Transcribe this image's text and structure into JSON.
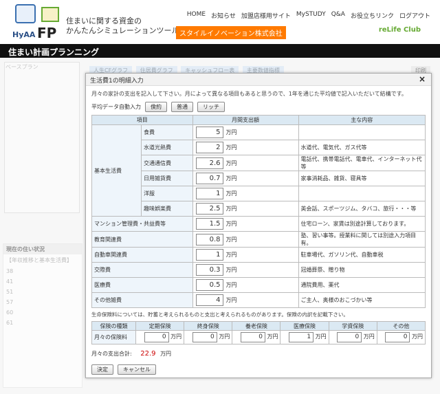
{
  "header": {
    "logo_text": "HyAA",
    "logo_fp": "FP",
    "title_line1": "住まいに関する資金の",
    "title_line2": "かんたんシミュレーションツール",
    "company": "スタイルイノベーション株式会社",
    "nav": [
      "HOME",
      "お知らせ",
      "加盟店様用サイト",
      "MySTUDY",
      "Q&A",
      "お役立ちリンク",
      "ログアウト"
    ],
    "partner": "reLife Club"
  },
  "titlebar": "住まい計画プランニング",
  "background": {
    "panel_label": "ベースプラン",
    "tabs": [
      "人生CFグラフ",
      "住居費グラフ",
      "キャッシュフロー表",
      "主要数値指標"
    ],
    "print": "印刷",
    "status_title": "現在の住い状況",
    "status_sub": "【年収推移と基本生活費】",
    "rows": [
      "38",
      "41",
      "51",
      "57",
      "60",
      "61"
    ]
  },
  "modal": {
    "title": "生活費1の明細入力",
    "close": "×",
    "instruction": "月々の家計の支出を記入して下さい。月によって異なる項目もあると思うので、1年を通じた平均値で記入いただいて結構です。",
    "preset_label": "平均データ自動入力",
    "presets": [
      "倹約",
      "普通",
      "リッチ"
    ],
    "headers": [
      "項目",
      "月間支出額",
      "主な内容"
    ],
    "unit": "万円",
    "basic_label": "基本生活費",
    "basic_items": [
      {
        "label": "食費",
        "value": "5",
        "desc": ""
      },
      {
        "label": "水道光熱費",
        "value": "2",
        "desc": "水道代、電気代、ガス代等"
      },
      {
        "label": "交通通信費",
        "value": "2.6",
        "desc": "電話代、携帯電話代、電車代、インターネット代等"
      },
      {
        "label": "日用雑貨費",
        "value": "0.7",
        "desc": "家事消耗品、雑貨、寝具等"
      },
      {
        "label": "洋服",
        "value": "1",
        "desc": ""
      },
      {
        "label": "趣味娯楽費",
        "value": "2.5",
        "desc": "英会話、スポーツジム、タバコ、旅行・・・等"
      }
    ],
    "other_items": [
      {
        "label": "マンション管理費・共益費等",
        "value": "1.5",
        "desc": "住宅ローン、家賃は別途計算しております。"
      },
      {
        "label": "教育関連費",
        "value": "0.8",
        "desc": "塾、習い事等。授業料に関しては別途入力項目有。"
      },
      {
        "label": "自動車関連費",
        "value": "1",
        "desc": "駐車場代、ガソリン代、自動車税"
      },
      {
        "label": "交際費",
        "value": "0.3",
        "desc": "冠婚葬祭、贈り物"
      },
      {
        "label": "医療費",
        "value": "0.5",
        "desc": "通院費用、薬代"
      },
      {
        "label": "その他雑費",
        "value": "4",
        "desc": "ご主人、奥様のおこづかい等"
      }
    ],
    "insurance_note": "生命保険料については、貯蓄と考えられるものと支出と考えられるものがあります。保険の内訳を記載下さい。",
    "insurance_headers": [
      "保険の種類",
      "定期保険",
      "終身保険",
      "養老保険",
      "医療保険",
      "学資保険",
      "その他"
    ],
    "insurance_row_label": "月々の保険料",
    "insurance_values": [
      "0",
      "0",
      "0",
      "1",
      "0",
      "0"
    ],
    "total_label": "月々の支出合計:",
    "total_value": "22.9",
    "total_unit": "万円",
    "ok": "決定",
    "cancel": "キャンセル"
  }
}
